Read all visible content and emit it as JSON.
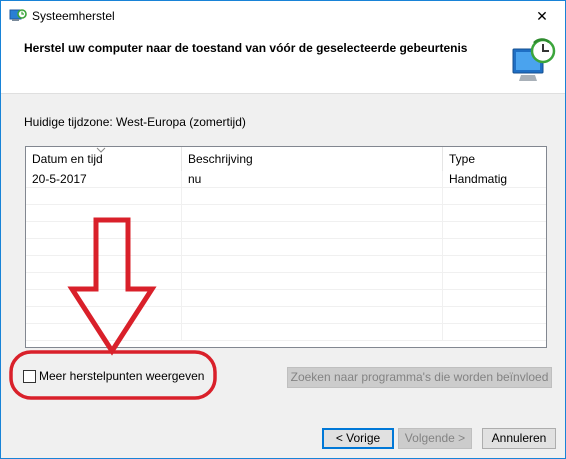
{
  "window": {
    "title": "Systeemherstel",
    "close_glyph": "✕"
  },
  "header": {
    "title": "Herstel uw computer naar de toestand van vóór de geselecteerde gebeurtenis",
    "icon": "system-restore-icon"
  },
  "timezone_label": "Huidige tijdzone: West-Europa (zomertijd)",
  "table": {
    "columns": [
      "Datum en tijd",
      "Beschrijving",
      "Type"
    ],
    "rows": [
      [
        "20-5-2017",
        "nu",
        "Handmatig"
      ]
    ],
    "sort_indicator": "chevron-down-icon"
  },
  "show_more": {
    "label": "Meer herstelpunten weergeven",
    "checked": false
  },
  "buttons": {
    "scan": "Zoeken naar programma's die worden beïnvloed",
    "back": "< Vorige",
    "next": "Volgende >",
    "cancel": "Annuleren"
  },
  "annotation_color": "#d9202a"
}
